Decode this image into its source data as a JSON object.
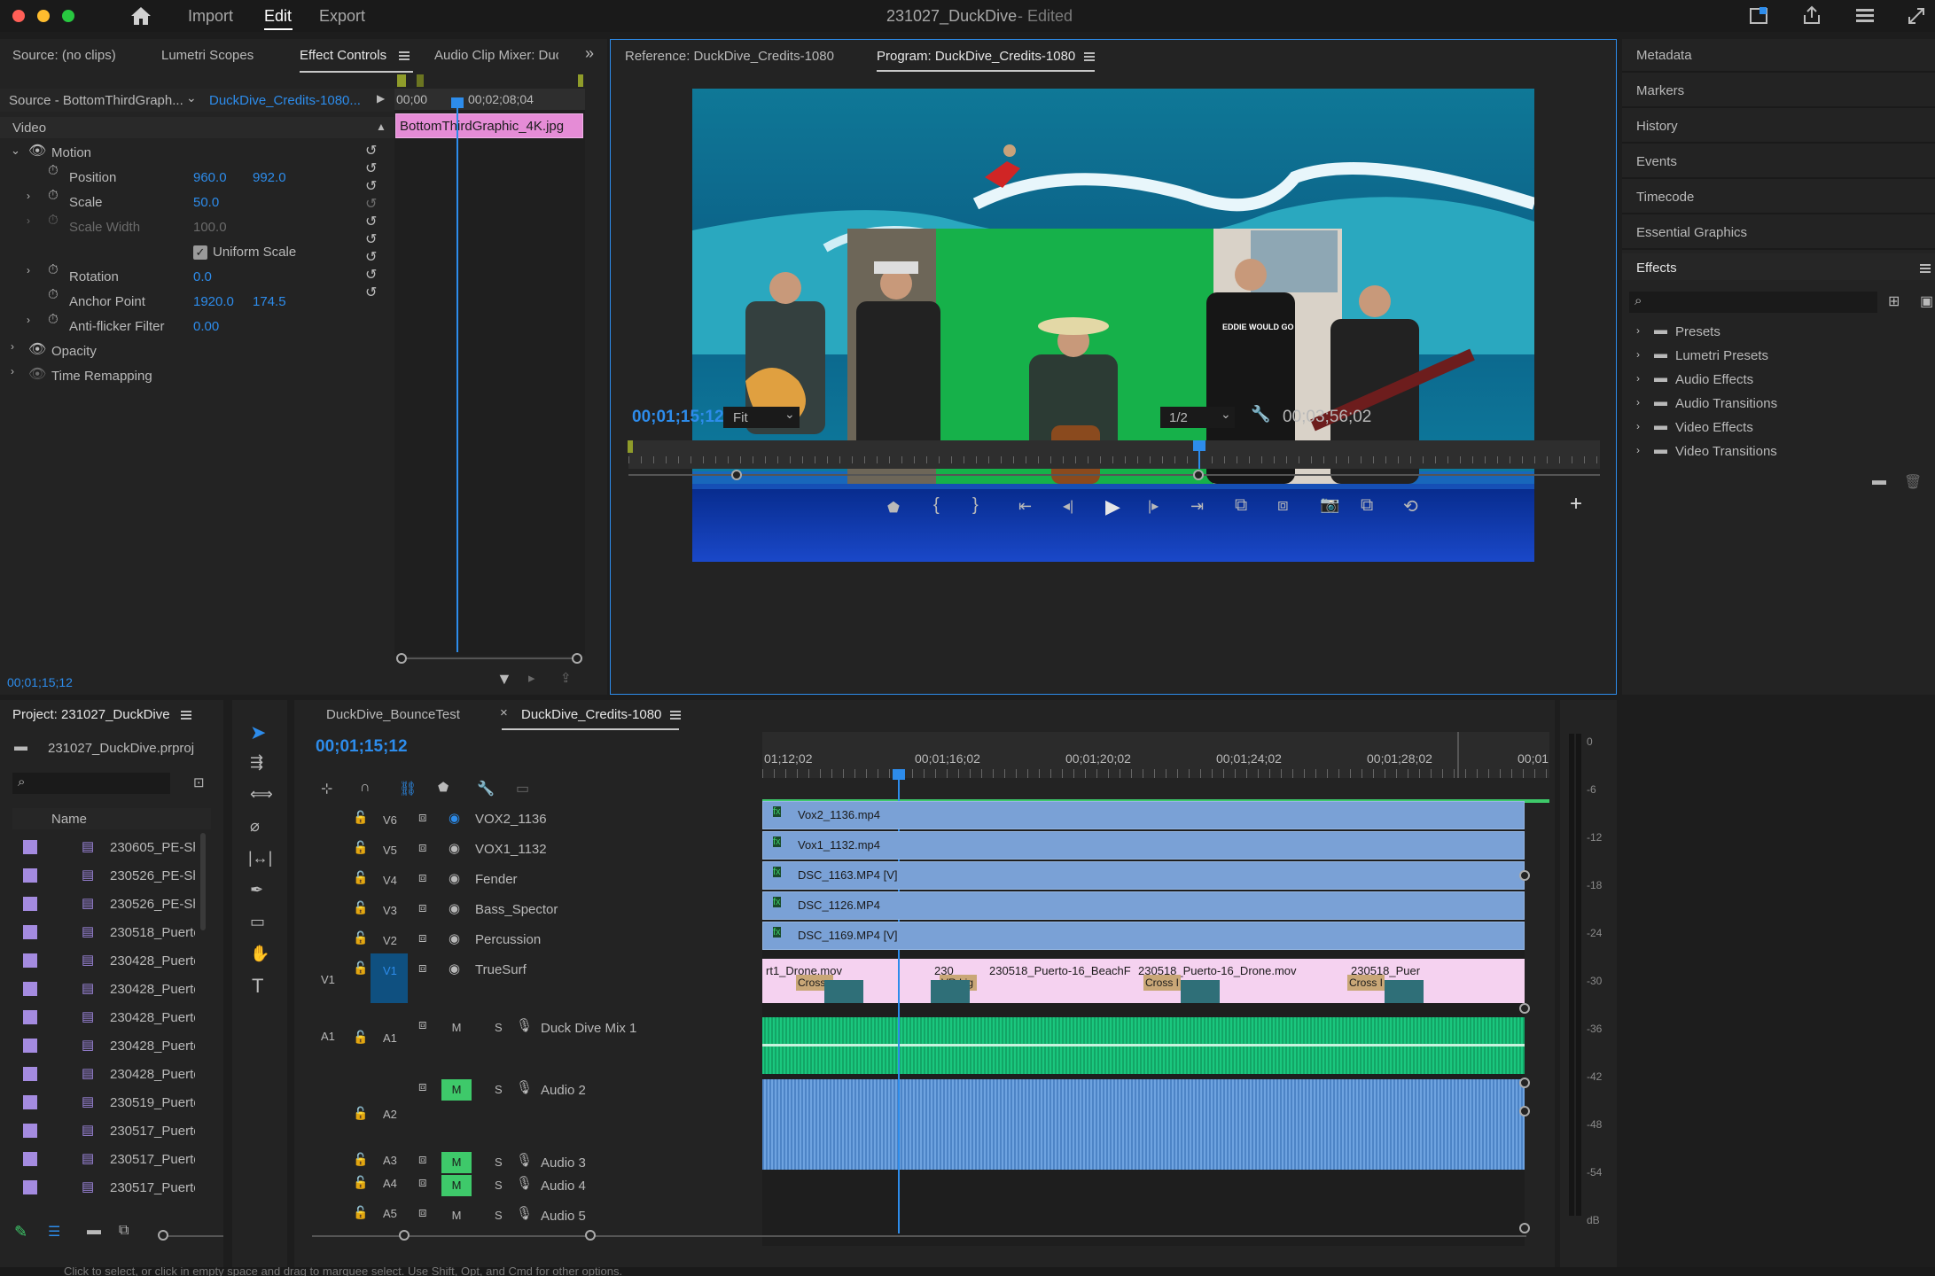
{
  "titlebar": {
    "title": "231027_DuckDive",
    "status": "- Edited",
    "nav": [
      "Import",
      "Edit",
      "Export"
    ]
  },
  "source_tabs": [
    "Source: (no clips)",
    "Lumetri Scopes",
    "Effect Controls",
    "Audio Clip Mixer: Duc"
  ],
  "effect_controls": {
    "source_label": "Source - BottomThirdGraph...",
    "sequence_label": "DuckDive_Credits-1080...",
    "ruler_start": "00;00",
    "ruler_mid": "00;02;08;04",
    "clip_name": "BottomThirdGraphic_4K.jpg",
    "video_header": "Video",
    "motion": "Motion",
    "position_label": "Position",
    "position_x": "960.0",
    "position_y": "992.0",
    "scale_label": "Scale",
    "scale_value": "50.0",
    "scale_width_label": "Scale Width",
    "scale_width_value": "100.0",
    "uniform_scale_label": "Uniform Scale",
    "rotation_label": "Rotation",
    "rotation_value": "0.0",
    "anchor_label": "Anchor Point",
    "anchor_x": "1920.0",
    "anchor_y": "174.5",
    "antiflicker_label": "Anti-flicker Filter",
    "antiflicker_value": "0.00",
    "opacity": "Opacity",
    "time_remap": "Time Remapping",
    "timecode": "00;01;15;12"
  },
  "program": {
    "tabs": [
      "Reference: DuckDive_Credits-1080",
      "Program: DuckDive_Credits-1080"
    ],
    "timecode": "00;01;15;12",
    "fit": "Fit",
    "resolution": "1/2",
    "duration": "00;03;56;02",
    "shirt_text": "EDDIE WOULD GO"
  },
  "right_panel": {
    "items": [
      "Metadata",
      "Markers",
      "History",
      "Events",
      "Timecode",
      "Essential Graphics"
    ],
    "effects_title": "Effects",
    "effects_tree": [
      "Presets",
      "Lumetri Presets",
      "Audio Effects",
      "Audio Transitions",
      "Video Effects",
      "Video Transitions"
    ]
  },
  "project": {
    "title": "Project: 231027_DuckDive",
    "file": "231027_DuckDive.prproj",
    "column": "Name",
    "items": [
      "230605_PE-Sh",
      "230526_PE-Sh",
      "230526_PE-Sh",
      "230518_Puerto",
      "230428_Puerto",
      "230428_Puerto",
      "230428_Puerto",
      "230428_Puerto",
      "230428_Puerto",
      "230519_Puerto",
      "230517_Puerto",
      "230517_Puerto",
      "230517_Puerto"
    ]
  },
  "timeline": {
    "tabs": [
      "DuckDive_BounceTest",
      "DuckDive_Credits-1080"
    ],
    "timecode": "00;01;15;12",
    "ruler": [
      "01;12;02",
      "00;01;16;02",
      "00;01;20;02",
      "00;01;24;02",
      "00;01;28;02",
      "00;01"
    ],
    "video_tracks": [
      {
        "id": "V6",
        "name": "VOX2_1136",
        "clip": "Vox2_1136.mp4"
      },
      {
        "id": "V5",
        "name": "VOX1_1132",
        "clip": "Vox1_1132.mp4"
      },
      {
        "id": "V4",
        "name": "Fender",
        "clip": "DSC_1163.MP4 [V]"
      },
      {
        "id": "V3",
        "name": "Bass_Spector",
        "clip": "DSC_1126.MP4"
      },
      {
        "id": "V2",
        "name": "Percussion",
        "clip": "DSC_1169.MP4 [V]"
      },
      {
        "id": "V1",
        "name": "TrueSurf",
        "clip": ""
      }
    ],
    "v1_source": "V1",
    "v1_clips": [
      "rt1_Drone.mov",
      "230",
      "230518_Puerto-16_BeachF",
      "230518_Puerto-16_Drone.mov",
      "230518_Puer"
    ],
    "v1_transitions": [
      "Cross",
      "VR Lig",
      "Cross I",
      "Cross I"
    ],
    "audio_tracks": [
      {
        "src": "A1",
        "id": "A1",
        "m": "M",
        "s": "S",
        "name": "Duck Dive Mix 1"
      },
      {
        "src": "",
        "id": "A2",
        "m": "M",
        "s": "S",
        "name": "Audio 2"
      },
      {
        "src": "",
        "id": "A3",
        "m": "M",
        "s": "S",
        "name": "Audio 3"
      },
      {
        "src": "",
        "id": "A4",
        "m": "M",
        "s": "S",
        "name": "Audio 4"
      },
      {
        "src": "",
        "id": "A5",
        "m": "M",
        "s": "S",
        "name": "Audio 5"
      }
    ]
  },
  "meter": {
    "labels": [
      "0",
      "-6",
      "-12",
      "-18",
      "-24",
      "-30",
      "-36",
      "-42",
      "-48",
      "-54",
      "dB"
    ]
  },
  "status_bar": "Click to select, or click in empty space and drag to marquee select. Use Shift, Opt, and Cmd for other options."
}
